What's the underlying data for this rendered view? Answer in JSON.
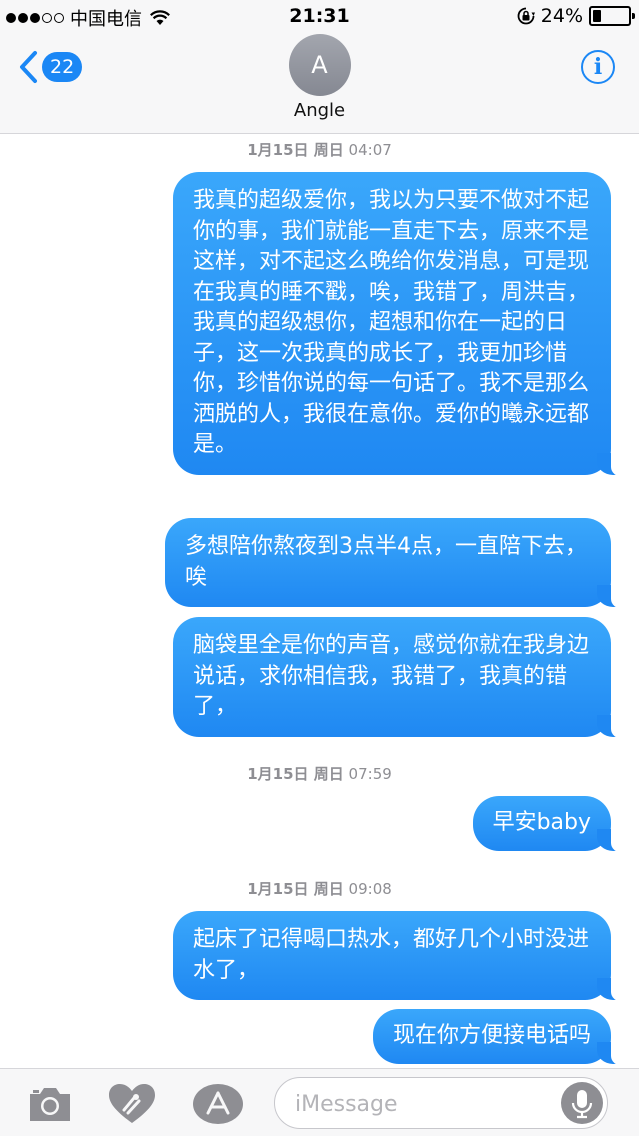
{
  "status_bar": {
    "carrier": "中国电信",
    "time": "21:31",
    "battery_percent": "24%",
    "battery_level": 0.24,
    "signal_bars_filled": 3,
    "signal_bars_total": 5
  },
  "nav": {
    "back_count": "22",
    "contact_initial": "A",
    "contact_name": "Angle",
    "info_label": "i"
  },
  "timestamps": [
    {
      "day": "1月15日 周日",
      "time": "04:07"
    },
    {
      "day": "1月15日 周日",
      "time": "07:59"
    },
    {
      "day": "1月15日 周日",
      "time": "09:08"
    }
  ],
  "messages": [
    {
      "text": "我真的超级爱你，我以为只要不做对不起你的事，我们就能一直走下去，原来不是这样，对不起这么晚给你发消息，可是现在我真的睡不戳，唉，我错了，周洪吉，我真的超级想你，超想和你在一起的日子，这一次我真的成长了，我更加珍惜你，珍惜你说的每一句话了。我不是那么洒脱的人，我很在意你。爱你的曦永远都是。"
    },
    {
      "text": "多想陪你熬夜到3点半4点，一直陪下去，唉"
    },
    {
      "text": "脑袋里全是你的声音，感觉你就在我身边说话，求你相信我，我错了，我真的错了，"
    },
    {
      "text": "早安baby"
    },
    {
      "text": "起床了记得喝口热水，都好几个小时没进水了，"
    },
    {
      "text": "现在你方便接电话吗"
    }
  ],
  "input": {
    "placeholder": "iMessage"
  },
  "icons": {
    "camera": "camera-icon",
    "digital_touch": "digital-touch-heart-icon",
    "app_store": "app-store-icon",
    "mic": "microphone-icon",
    "back": "chevron-left-icon",
    "info": "info-icon"
  },
  "colors": {
    "bubble": "#1f88f2",
    "accent": "#1b87f5"
  }
}
